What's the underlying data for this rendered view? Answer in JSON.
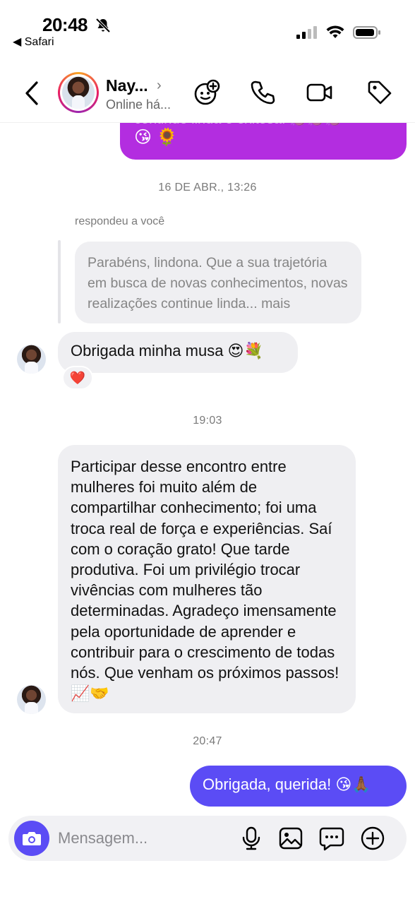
{
  "status_bar": {
    "time": "20:48",
    "back_app": "◀ Safari"
  },
  "header": {
    "contact_name": "Nay...",
    "contact_status": "Online há...",
    "icons": [
      "back-chevron-icon",
      "avatar-sticker-icon",
      "phone-icon",
      "video-icon",
      "tag-icon"
    ]
  },
  "messages": {
    "top_cut_text": "continue linda e exitosa! 👏🏽👏🏽👏🏽",
    "top_cut_emoji": "😘 🌻",
    "timestamp_1": "16 DE ABR., 13:26",
    "replied_label": "respondeu a você",
    "reply_quote": "Parabéns, lindona. Que a sua trajetória em busca de novas conhecimentos, novas realizações continue linda... mais",
    "msg_1": "Obrigada minha musa 😍💐",
    "reaction_1": "❤️",
    "timestamp_2": "19:03",
    "msg_2": "Participar desse encontro entre mulheres foi muito além de compartilhar conhecimento; foi uma troca real de força e experiências. Saí com o coração grato! Que tarde produtiva. Foi um privilégio trocar vivências com mulheres tão determinadas. Agradeço imensamente pela oportunidade de aprender e contribuir para o crescimento de todas nós. Que venham os próximos passos! 📈🤝",
    "timestamp_3": "20:47",
    "msg_out": "Obrigada, querida! 😘🙏🏾"
  },
  "composer": {
    "placeholder": "Mensagem...",
    "icons": [
      "camera-icon",
      "microphone-icon",
      "gallery-icon",
      "sticker-icon",
      "plus-icon"
    ]
  },
  "colors": {
    "outgoing_bubble": "#5b4cf5",
    "sent_older_bubble": "#b32de0",
    "incoming_bubble": "#efeff2"
  }
}
